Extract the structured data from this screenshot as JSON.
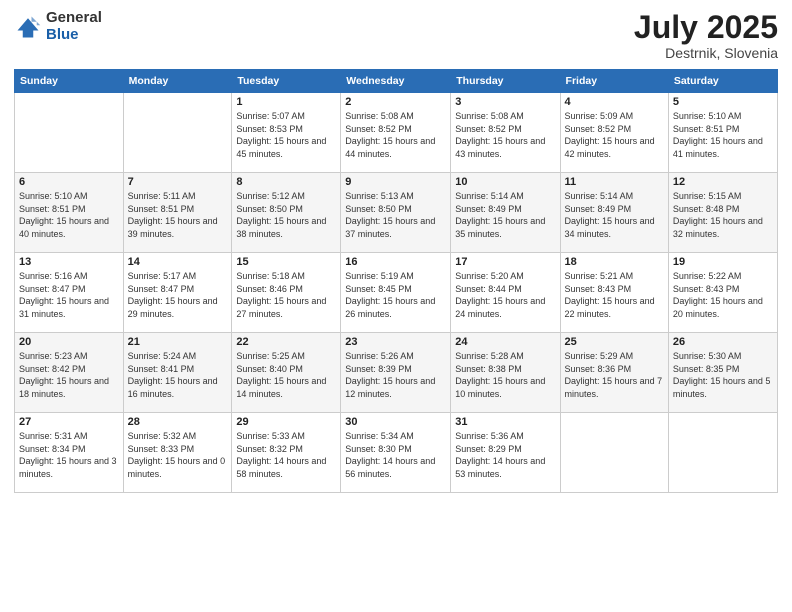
{
  "logo": {
    "general": "General",
    "blue": "Blue"
  },
  "title": {
    "month_year": "July 2025",
    "location": "Destrnik, Slovenia"
  },
  "headers": [
    "Sunday",
    "Monday",
    "Tuesday",
    "Wednesday",
    "Thursday",
    "Friday",
    "Saturday"
  ],
  "weeks": [
    [
      {
        "day": "",
        "sunrise": "",
        "sunset": "",
        "daylight": ""
      },
      {
        "day": "",
        "sunrise": "",
        "sunset": "",
        "daylight": ""
      },
      {
        "day": "1",
        "sunrise": "Sunrise: 5:07 AM",
        "sunset": "Sunset: 8:53 PM",
        "daylight": "Daylight: 15 hours and 45 minutes."
      },
      {
        "day": "2",
        "sunrise": "Sunrise: 5:08 AM",
        "sunset": "Sunset: 8:52 PM",
        "daylight": "Daylight: 15 hours and 44 minutes."
      },
      {
        "day": "3",
        "sunrise": "Sunrise: 5:08 AM",
        "sunset": "Sunset: 8:52 PM",
        "daylight": "Daylight: 15 hours and 43 minutes."
      },
      {
        "day": "4",
        "sunrise": "Sunrise: 5:09 AM",
        "sunset": "Sunset: 8:52 PM",
        "daylight": "Daylight: 15 hours and 42 minutes."
      },
      {
        "day": "5",
        "sunrise": "Sunrise: 5:10 AM",
        "sunset": "Sunset: 8:51 PM",
        "daylight": "Daylight: 15 hours and 41 minutes."
      }
    ],
    [
      {
        "day": "6",
        "sunrise": "Sunrise: 5:10 AM",
        "sunset": "Sunset: 8:51 PM",
        "daylight": "Daylight: 15 hours and 40 minutes."
      },
      {
        "day": "7",
        "sunrise": "Sunrise: 5:11 AM",
        "sunset": "Sunset: 8:51 PM",
        "daylight": "Daylight: 15 hours and 39 minutes."
      },
      {
        "day": "8",
        "sunrise": "Sunrise: 5:12 AM",
        "sunset": "Sunset: 8:50 PM",
        "daylight": "Daylight: 15 hours and 38 minutes."
      },
      {
        "day": "9",
        "sunrise": "Sunrise: 5:13 AM",
        "sunset": "Sunset: 8:50 PM",
        "daylight": "Daylight: 15 hours and 37 minutes."
      },
      {
        "day": "10",
        "sunrise": "Sunrise: 5:14 AM",
        "sunset": "Sunset: 8:49 PM",
        "daylight": "Daylight: 15 hours and 35 minutes."
      },
      {
        "day": "11",
        "sunrise": "Sunrise: 5:14 AM",
        "sunset": "Sunset: 8:49 PM",
        "daylight": "Daylight: 15 hours and 34 minutes."
      },
      {
        "day": "12",
        "sunrise": "Sunrise: 5:15 AM",
        "sunset": "Sunset: 8:48 PM",
        "daylight": "Daylight: 15 hours and 32 minutes."
      }
    ],
    [
      {
        "day": "13",
        "sunrise": "Sunrise: 5:16 AM",
        "sunset": "Sunset: 8:47 PM",
        "daylight": "Daylight: 15 hours and 31 minutes."
      },
      {
        "day": "14",
        "sunrise": "Sunrise: 5:17 AM",
        "sunset": "Sunset: 8:47 PM",
        "daylight": "Daylight: 15 hours and 29 minutes."
      },
      {
        "day": "15",
        "sunrise": "Sunrise: 5:18 AM",
        "sunset": "Sunset: 8:46 PM",
        "daylight": "Daylight: 15 hours and 27 minutes."
      },
      {
        "day": "16",
        "sunrise": "Sunrise: 5:19 AM",
        "sunset": "Sunset: 8:45 PM",
        "daylight": "Daylight: 15 hours and 26 minutes."
      },
      {
        "day": "17",
        "sunrise": "Sunrise: 5:20 AM",
        "sunset": "Sunset: 8:44 PM",
        "daylight": "Daylight: 15 hours and 24 minutes."
      },
      {
        "day": "18",
        "sunrise": "Sunrise: 5:21 AM",
        "sunset": "Sunset: 8:43 PM",
        "daylight": "Daylight: 15 hours and 22 minutes."
      },
      {
        "day": "19",
        "sunrise": "Sunrise: 5:22 AM",
        "sunset": "Sunset: 8:43 PM",
        "daylight": "Daylight: 15 hours and 20 minutes."
      }
    ],
    [
      {
        "day": "20",
        "sunrise": "Sunrise: 5:23 AM",
        "sunset": "Sunset: 8:42 PM",
        "daylight": "Daylight: 15 hours and 18 minutes."
      },
      {
        "day": "21",
        "sunrise": "Sunrise: 5:24 AM",
        "sunset": "Sunset: 8:41 PM",
        "daylight": "Daylight: 15 hours and 16 minutes."
      },
      {
        "day": "22",
        "sunrise": "Sunrise: 5:25 AM",
        "sunset": "Sunset: 8:40 PM",
        "daylight": "Daylight: 15 hours and 14 minutes."
      },
      {
        "day": "23",
        "sunrise": "Sunrise: 5:26 AM",
        "sunset": "Sunset: 8:39 PM",
        "daylight": "Daylight: 15 hours and 12 minutes."
      },
      {
        "day": "24",
        "sunrise": "Sunrise: 5:28 AM",
        "sunset": "Sunset: 8:38 PM",
        "daylight": "Daylight: 15 hours and 10 minutes."
      },
      {
        "day": "25",
        "sunrise": "Sunrise: 5:29 AM",
        "sunset": "Sunset: 8:36 PM",
        "daylight": "Daylight: 15 hours and 7 minutes."
      },
      {
        "day": "26",
        "sunrise": "Sunrise: 5:30 AM",
        "sunset": "Sunset: 8:35 PM",
        "daylight": "Daylight: 15 hours and 5 minutes."
      }
    ],
    [
      {
        "day": "27",
        "sunrise": "Sunrise: 5:31 AM",
        "sunset": "Sunset: 8:34 PM",
        "daylight": "Daylight: 15 hours and 3 minutes."
      },
      {
        "day": "28",
        "sunrise": "Sunrise: 5:32 AM",
        "sunset": "Sunset: 8:33 PM",
        "daylight": "Daylight: 15 hours and 0 minutes."
      },
      {
        "day": "29",
        "sunrise": "Sunrise: 5:33 AM",
        "sunset": "Sunset: 8:32 PM",
        "daylight": "Daylight: 14 hours and 58 minutes."
      },
      {
        "day": "30",
        "sunrise": "Sunrise: 5:34 AM",
        "sunset": "Sunset: 8:30 PM",
        "daylight": "Daylight: 14 hours and 56 minutes."
      },
      {
        "day": "31",
        "sunrise": "Sunrise: 5:36 AM",
        "sunset": "Sunset: 8:29 PM",
        "daylight": "Daylight: 14 hours and 53 minutes."
      },
      {
        "day": "",
        "sunrise": "",
        "sunset": "",
        "daylight": ""
      },
      {
        "day": "",
        "sunrise": "",
        "sunset": "",
        "daylight": ""
      }
    ]
  ]
}
